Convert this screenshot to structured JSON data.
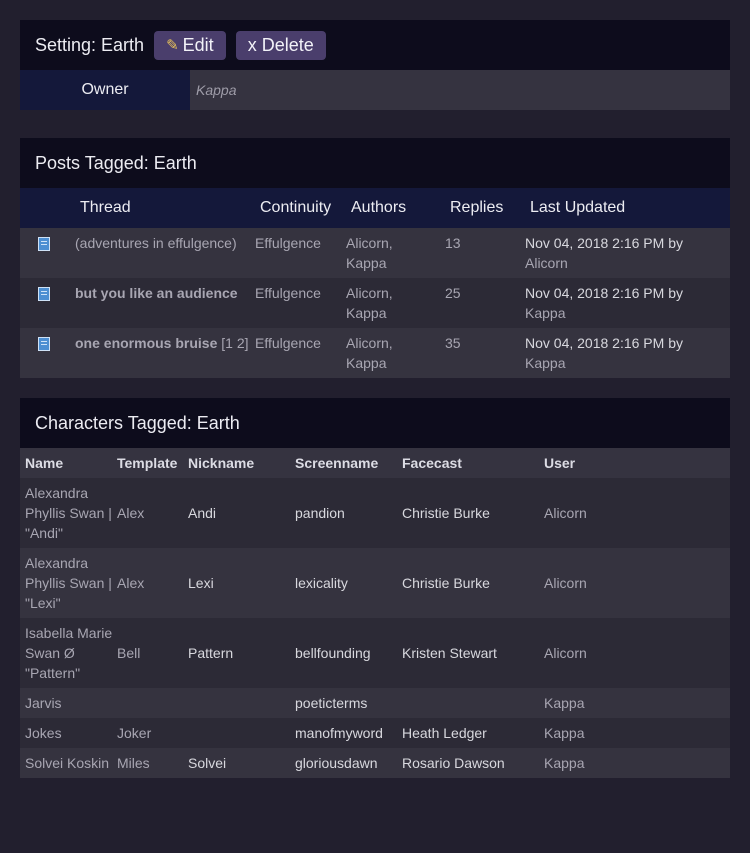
{
  "setting": {
    "title": "Setting: Earth",
    "edit_label": "Edit",
    "delete_label": "x Delete",
    "owner_label": "Owner",
    "owner_value": "Kappa"
  },
  "posts": {
    "title": "Posts Tagged: Earth",
    "columns": [
      "Thread",
      "Continuity",
      "Authors",
      "Replies",
      "Last Updated"
    ],
    "rows": [
      {
        "thread": "(adventures in effulgence)",
        "continuity": "Effulgence",
        "authors_line1": "Alicorn,",
        "authors_line2": "Kappa",
        "replies": "13",
        "updated": "Nov 04, 2018 2:16 PM by",
        "updated_by": "Alicorn"
      },
      {
        "thread": "but you like an audience",
        "continuity": "Effulgence",
        "authors_line1": "Alicorn,",
        "authors_line2": "Kappa",
        "replies": "25",
        "updated": "Nov 04, 2018 2:16 PM by",
        "updated_by": "Kappa"
      },
      {
        "thread": "one enormous bruise",
        "pages": "[1 2]",
        "continuity": "Effulgence",
        "authors_line1": "Alicorn,",
        "authors_line2": "Kappa",
        "replies": "35",
        "updated": "Nov 04, 2018 2:16 PM by",
        "updated_by": "Kappa"
      }
    ]
  },
  "characters": {
    "title": "Characters Tagged: Earth",
    "columns": [
      "Name",
      "Template",
      "Nickname",
      "Screenname",
      "Facecast",
      "User"
    ],
    "rows": [
      {
        "name": "Alexandra Phyllis Swan | \"Andi\"",
        "template": "Alex",
        "nickname": "Andi",
        "screenname": "pandion",
        "facecast": "Christie Burke",
        "user": "Alicorn"
      },
      {
        "name": "Alexandra Phyllis Swan | \"Lexi\"",
        "template": "Alex",
        "nickname": "Lexi",
        "screenname": "lexicality",
        "facecast": "Christie Burke",
        "user": "Alicorn"
      },
      {
        "name": "Isabella Marie Swan Ø \"Pattern\"",
        "template": "Bell",
        "nickname": "Pattern",
        "screenname": "bellfounding",
        "facecast": "Kristen Stewart",
        "user": "Alicorn"
      },
      {
        "name": "Jarvis",
        "template": "",
        "nickname": "",
        "screenname": "poeticterms",
        "facecast": "",
        "user": "Kappa"
      },
      {
        "name": "Jokes",
        "template": "Joker",
        "nickname": "",
        "screenname": "manofmyword",
        "facecast": "Heath Ledger",
        "user": "Kappa"
      },
      {
        "name": "Solvei Koskin",
        "template": "Miles",
        "nickname": "Solvei",
        "screenname": "gloriousdawn",
        "facecast": "Rosario Dawson",
        "user": "Kappa"
      }
    ]
  }
}
